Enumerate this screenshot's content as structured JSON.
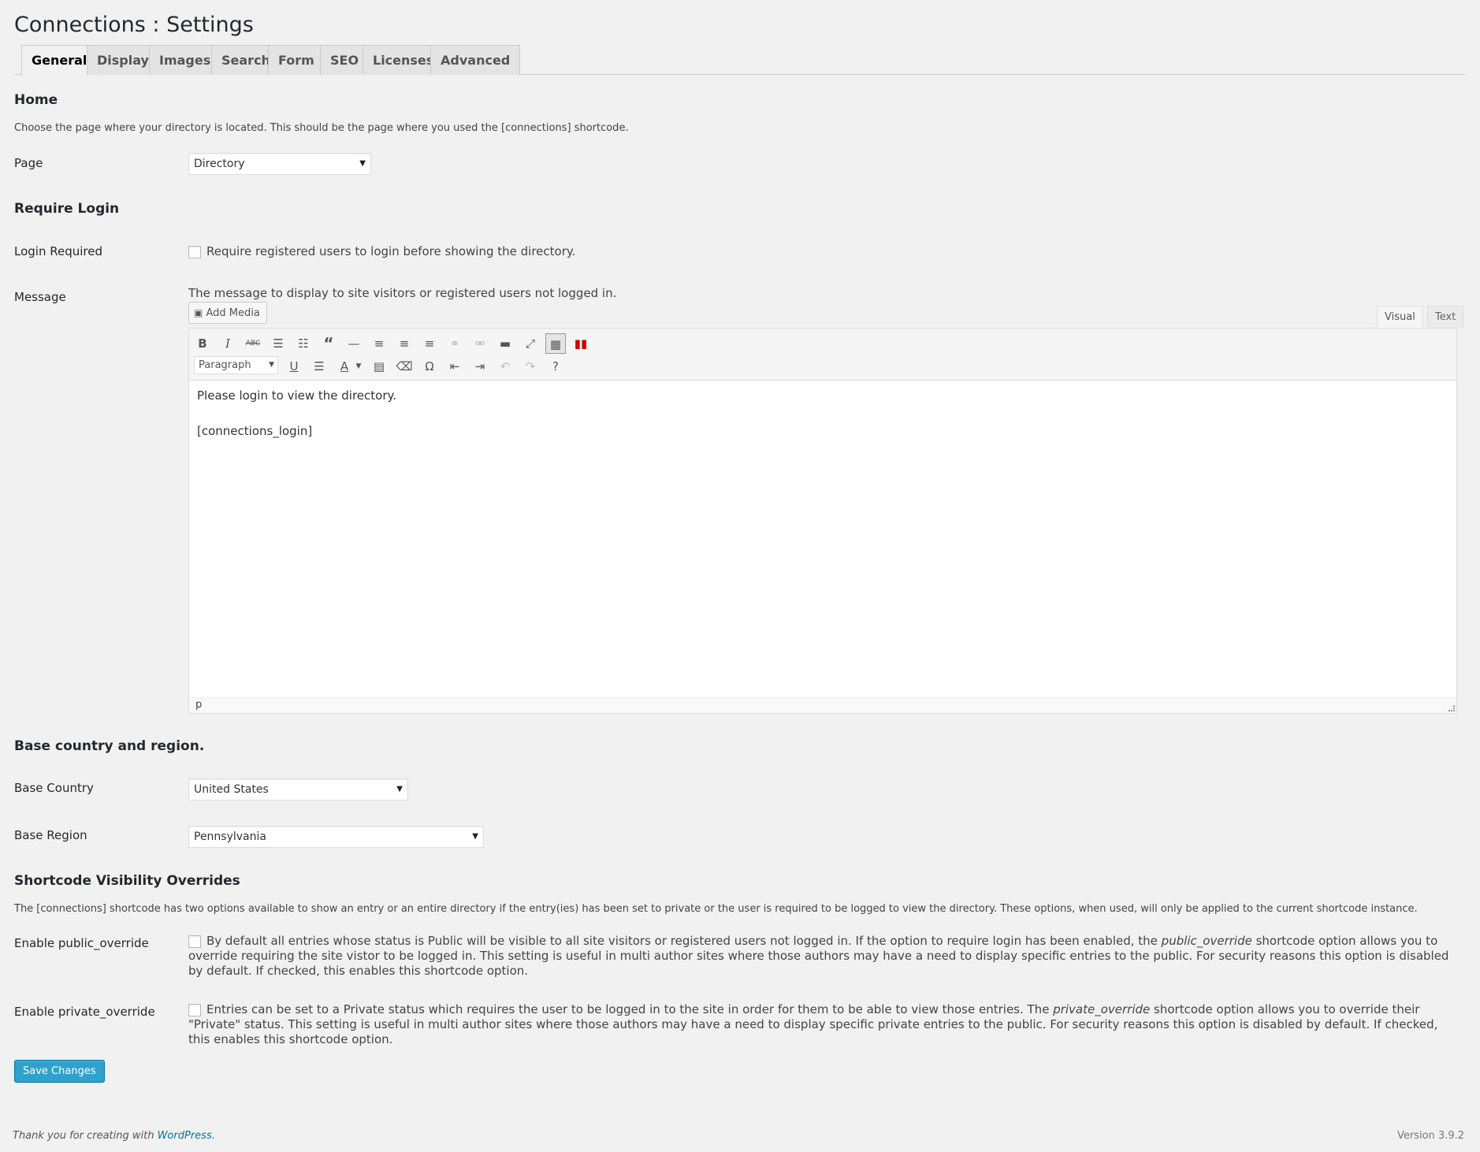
{
  "page": {
    "title": "Connections : Settings"
  },
  "tabs": [
    {
      "label": "General",
      "active": true
    },
    {
      "label": "Display"
    },
    {
      "label": "Images"
    },
    {
      "label": "Search"
    },
    {
      "label": "Form"
    },
    {
      "label": "SEO"
    },
    {
      "label": "Licenses"
    },
    {
      "label": "Advanced"
    }
  ],
  "home": {
    "heading": "Home",
    "description": "Choose the page where your directory is located. This should be the page where you used the [connections] shortcode.",
    "page_label": "Page",
    "page_value": "Directory"
  },
  "login": {
    "heading": "Require Login",
    "required_label": "Login Required",
    "required_text": "Require registered users to login before showing the directory.",
    "message_label": "Message",
    "message_desc": "The message to display to site visitors or registered users not logged in.",
    "add_media": "Add Media",
    "tab_visual": "Visual",
    "tab_text": "Text",
    "format_value": "Paragraph",
    "content_line1": "Please login to view the directory.",
    "content_line2": "[connections_login]",
    "status_path": "p"
  },
  "region": {
    "heading": "Base country and region.",
    "country_label": "Base Country",
    "country_value": "United States",
    "region_label": "Base Region",
    "region_value": "Pennsylvania"
  },
  "overrides": {
    "heading": "Shortcode Visibility Overrides",
    "description": "The [connections] shortcode has two options available to show an entry or an entire directory if the entry(ies) has been set to private or the user is required to be logged to view the directory. These options, when used, will only be applied to the current shortcode instance.",
    "public_label": "Enable public_override",
    "public_text_a": "By default all entries whose status is Public will be visible to all site visitors or registered users not logged in. If the option to require login has been enabled, the ",
    "public_text_em": "public_override",
    "public_text_b": " shortcode option allows you to override requiring the site vistor to be logged in. This setting is useful in multi author sites where those authors may have a need to display specific entries to the public. For security reasons this option is disabled by default. If checked, this enables this shortcode option.",
    "private_label": "Enable private_override",
    "private_text_a": "Entries can be set to a Private status which requires the user to be logged in to the site in order for them to be able to view those entries. The ",
    "private_text_em": "private_override",
    "private_text_b": " shortcode option allows you to override their \"Private\" status. This setting is useful in multi author sites where those authors may have a need to display specific private entries to the public. For security reasons this option is disabled by default. If checked, this enables this shortcode option."
  },
  "save_button": "Save Changes",
  "footer": {
    "thanks": "Thank you for creating with ",
    "link": "WordPress",
    "period": ".",
    "version": "Version 3.9.2"
  },
  "colors": {
    "primary": "#2ea2cc",
    "background": "#f1f1f1"
  }
}
